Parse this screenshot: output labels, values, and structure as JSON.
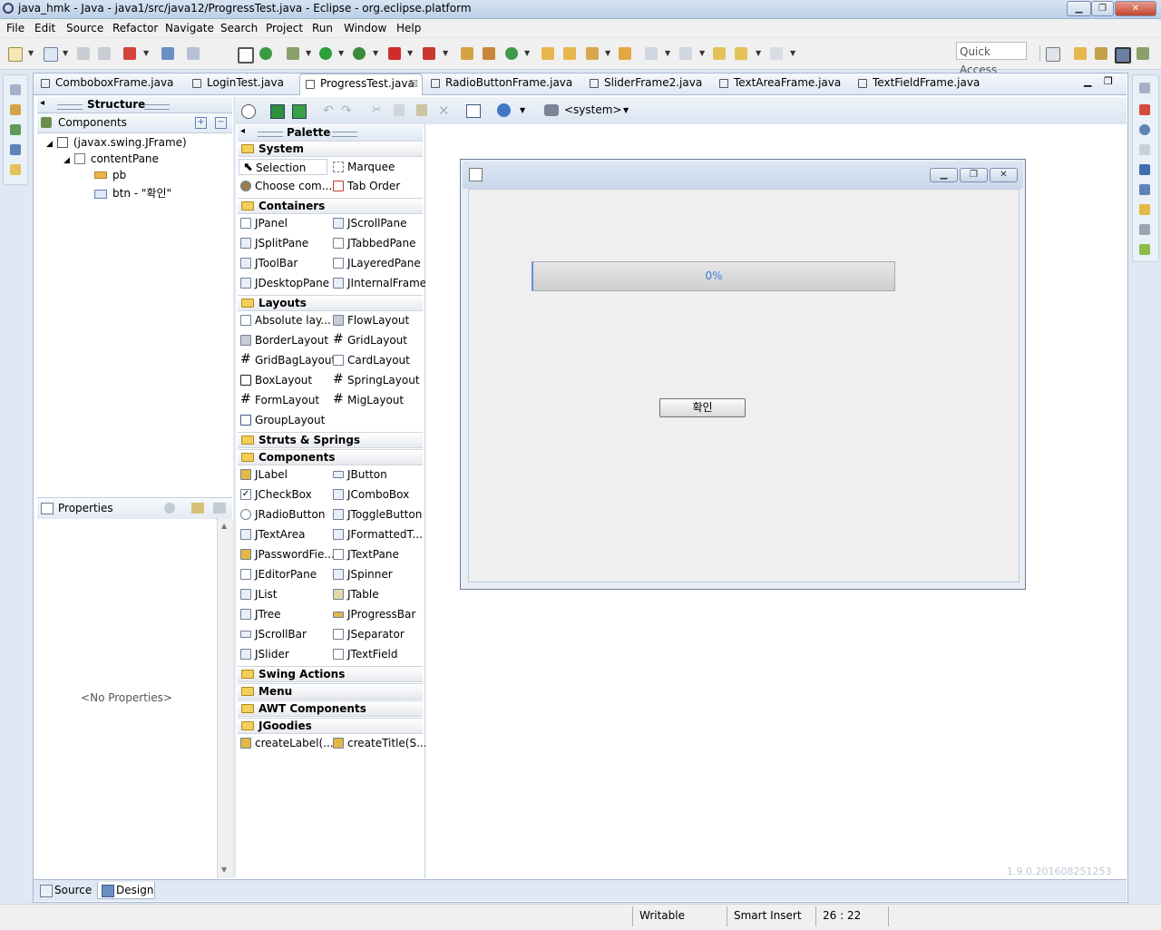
{
  "window": {
    "title": "java_hmk - Java - java1/src/java12/ProgressTest.java - Eclipse - org.eclipse.platform",
    "minimize": "▁",
    "restore": "❐",
    "close": "✕"
  },
  "menu": [
    "File",
    "Edit",
    "Source",
    "Refactor",
    "Navigate",
    "Search",
    "Project",
    "Run",
    "Window",
    "Help"
  ],
  "quick_access": "Quick Access",
  "tabs": [
    {
      "label": "ComboboxFrame.java"
    },
    {
      "label": "LoginTest.java"
    },
    {
      "label": "ProgressTest.java",
      "close": "☒"
    },
    {
      "label": "RadioButtonFrame.java"
    },
    {
      "label": "SliderFrame2.java"
    },
    {
      "label": "TextAreaFrame.java"
    },
    {
      "label": "TextFieldFrame.java"
    }
  ],
  "structure": {
    "title": "Structure",
    "components_label": "Components",
    "tree": [
      {
        "label": "(javax.swing.JFrame)"
      },
      {
        "label": "contentPane"
      },
      {
        "label": "pb"
      },
      {
        "label": "btn - \"확인\""
      }
    ]
  },
  "properties": {
    "title": "Properties",
    "empty": "<No Properties>"
  },
  "palette": {
    "title": "Palette",
    "system_label": "<system>",
    "categories": {
      "system": "System",
      "containers": "Containers",
      "layouts": "Layouts",
      "struts": "Struts & Springs",
      "components": "Components",
      "swing_actions": "Swing Actions",
      "menu": "Menu",
      "awt": "AWT Components",
      "jgoodies": "JGoodies"
    },
    "system": [
      "Selection",
      "Marquee",
      "Choose com...",
      "Tab Order"
    ],
    "containers": [
      "JPanel",
      "JScrollPane",
      "JSplitPane",
      "JTabbedPane",
      "JToolBar",
      "JLayeredPane",
      "JDesktopPane",
      "JInternalFrame"
    ],
    "layouts": [
      "Absolute lay...",
      "FlowLayout",
      "BorderLayout",
      "GridLayout",
      "GridBagLayout",
      "CardLayout",
      "BoxLayout",
      "SpringLayout",
      "FormLayout",
      "MigLayout",
      "GroupLayout"
    ],
    "components": [
      "JLabel",
      "JButton",
      "JCheckBox",
      "JComboBox",
      "JRadioButton",
      "JToggleButton",
      "JTextArea",
      "JFormattedT...",
      "JPasswordFie...",
      "JTextPane",
      "JEditorPane",
      "JSpinner",
      "JList",
      "JTable",
      "JTree",
      "JProgressBar",
      "JScrollBar",
      "JSeparator",
      "JSlider",
      "JTextField"
    ],
    "jgoodies": [
      "createLabel(...",
      "createTitle(S..."
    ]
  },
  "design": {
    "progress_text": "0%",
    "progress_value": 0,
    "button_label": "확인",
    "version": "1.9.0.201608251253"
  },
  "bottom_tabs": [
    "Source",
    "Design"
  ],
  "status": {
    "writable": "Writable",
    "insert_mode": "Smart Insert",
    "position": "26 : 22"
  }
}
